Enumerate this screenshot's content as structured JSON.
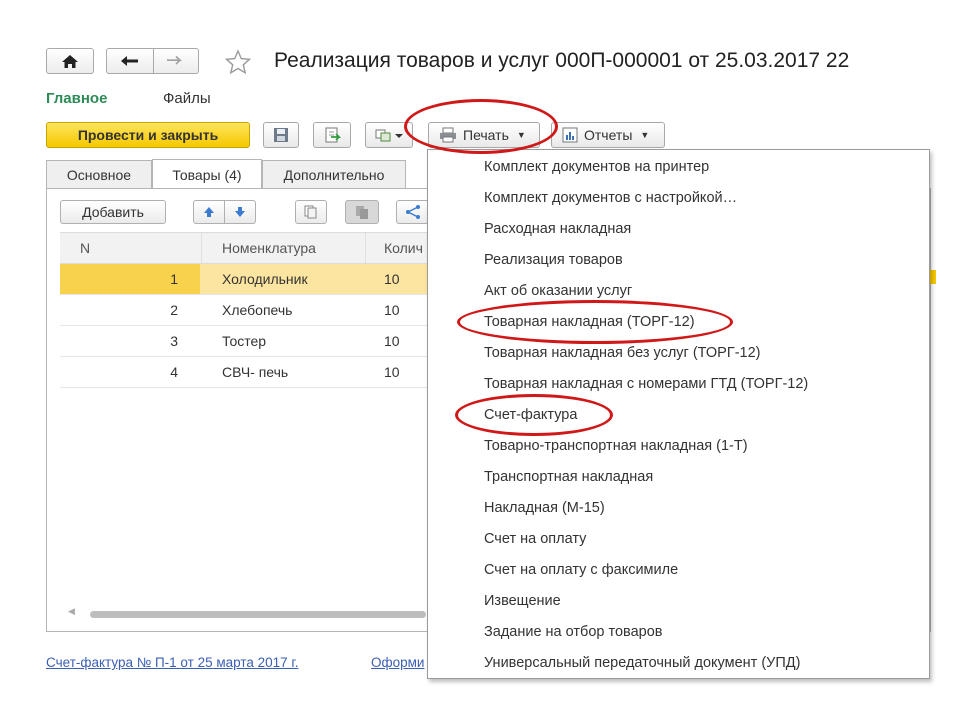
{
  "window": {
    "title": "Реализация товаров и услуг 000П-000001 от 25.03.2017 22"
  },
  "nav": {
    "main_link": "Главное",
    "files_link": "Файлы"
  },
  "toolbar": {
    "post_close_label": "Провести и закрыть",
    "print_label": "Печать",
    "reports_label": "Отчеты"
  },
  "tabs": [
    {
      "label": "Основное"
    },
    {
      "label": "Товары (4)"
    },
    {
      "label": "Дополнительно"
    }
  ],
  "table_toolbar": {
    "add_label": "Добавить"
  },
  "table": {
    "columns": [
      "N",
      "Номенклатура",
      "Колич"
    ],
    "rows": [
      {
        "n": "1",
        "name": "Холодильник",
        "qty": "10"
      },
      {
        "n": "2",
        "name": "Хлебопечь",
        "qty": "10"
      },
      {
        "n": "3",
        "name": "Тостер",
        "qty": "10"
      },
      {
        "n": "4",
        "name": "СВЧ- печь",
        "qty": "10"
      }
    ]
  },
  "print_menu": {
    "items": [
      "Комплект документов на принтер",
      "Комплект документов с настройкой…",
      "Расходная накладная",
      "Реализация товаров",
      "Акт об оказании услуг",
      "Товарная накладная (ТОРГ-12)",
      "Товарная накладная без услуг (ТОРГ-12)",
      "Товарная накладная с номерами ГТД (ТОРГ-12)",
      "Счет-фактура",
      "Товарно-транспортная накладная (1-Т)",
      "Транспортная накладная",
      "Накладная (М-15)",
      "Счет на оплату",
      "Счет на оплату с факсимиле",
      "Извещение",
      "Задание на отбор товаров",
      "Универсальный передаточный документ (УПД)"
    ]
  },
  "footer": {
    "invoice_link": "Счет-фактура № П-1 от 25 марта 2017 г.",
    "issue_link": "Оформи"
  },
  "colors": {
    "accent_link": "#3a5fb4",
    "main_tab_green": "#2e8b57",
    "primary_button": "#f5c800",
    "selected_row": "#fce5a0",
    "highlight_oval": "#d01818"
  }
}
